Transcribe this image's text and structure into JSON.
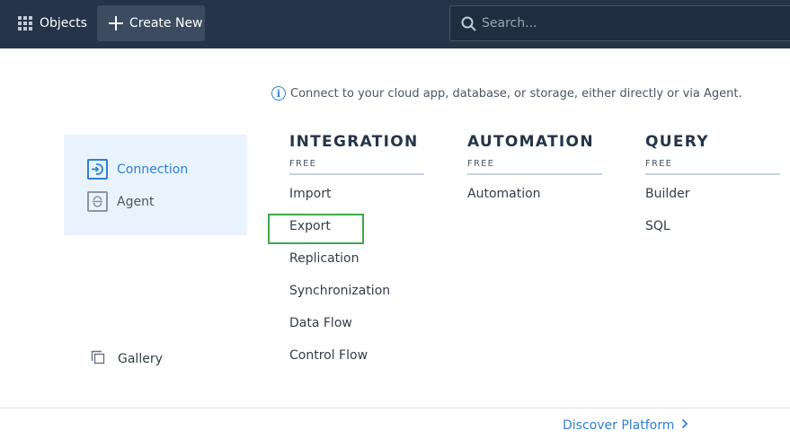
{
  "topbar": {
    "objects_label": "Objects",
    "create_label": "Create New",
    "search_placeholder": "Search..."
  },
  "info": {
    "text": "Connect to your cloud app, database, or storage, either directly or via Agent."
  },
  "left_panel": {
    "connection_label": "Connection",
    "agent_label": "Agent"
  },
  "gallery_label": "Gallery",
  "columns": [
    {
      "title": "INTEGRATION",
      "subtitle": "FREE",
      "items": [
        "Import",
        "Export",
        "Replication",
        "Synchronization",
        "Data Flow",
        "Control Flow"
      ]
    },
    {
      "title": "AUTOMATION",
      "subtitle": "FREE",
      "items": [
        "Automation"
      ]
    },
    {
      "title": "QUERY",
      "subtitle": "FREE",
      "items": [
        "Builder",
        "SQL"
      ]
    }
  ],
  "footer": {
    "discover_label": "Discover Platform"
  },
  "colors": {
    "topbar": "#253449",
    "accent": "#2f7fd3",
    "highlight": "#3ea84a",
    "panel": "#e9f3fd"
  },
  "icons": [
    "apps-grid-icon",
    "plus-icon",
    "search-icon",
    "info-icon",
    "connection-icon",
    "agent-icon",
    "gallery-icon",
    "chevron-right-icon"
  ]
}
